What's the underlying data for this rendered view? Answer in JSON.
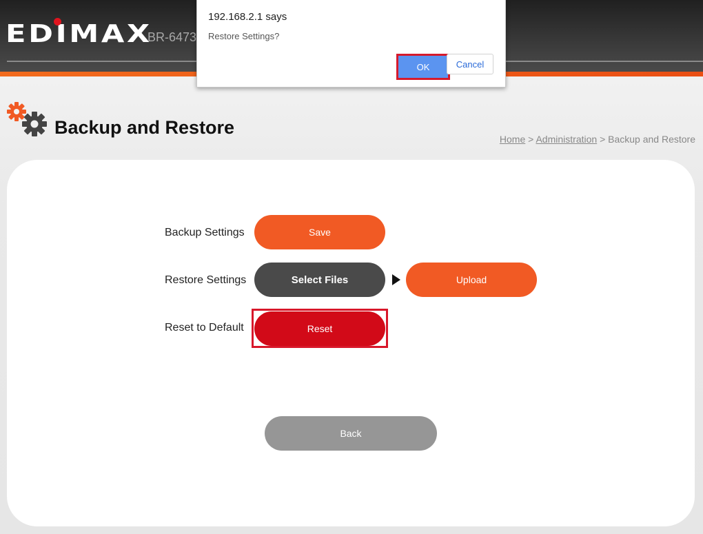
{
  "header": {
    "logo_text": "EDIMAX",
    "model": "BR-6473"
  },
  "page": {
    "title": "Backup and Restore",
    "breadcrumb": {
      "home": "Home",
      "sep1": ">",
      "admin": "Administration",
      "sep2": ">",
      "current": "Backup and Restore"
    }
  },
  "rows": {
    "backup_label": "Backup Settings",
    "save_label": "Save",
    "restore_label": "Restore Settings",
    "select_files_label": "Select Files",
    "upload_label": "Upload",
    "reset_label_text": "Reset to Default",
    "reset_button_label": "Reset"
  },
  "back_label": "Back",
  "dialog": {
    "origin": "192.168.2.1 says",
    "message": "Restore Settings?",
    "ok_label": "OK",
    "cancel_label": "Cancel"
  },
  "colors": {
    "brand_orange": "#f15a24",
    "reset_red": "#d20a18",
    "dialog_ok_blue": "#5b94f0",
    "highlight_red": "#d61a2c"
  },
  "icons": [
    "gear-icon"
  ]
}
